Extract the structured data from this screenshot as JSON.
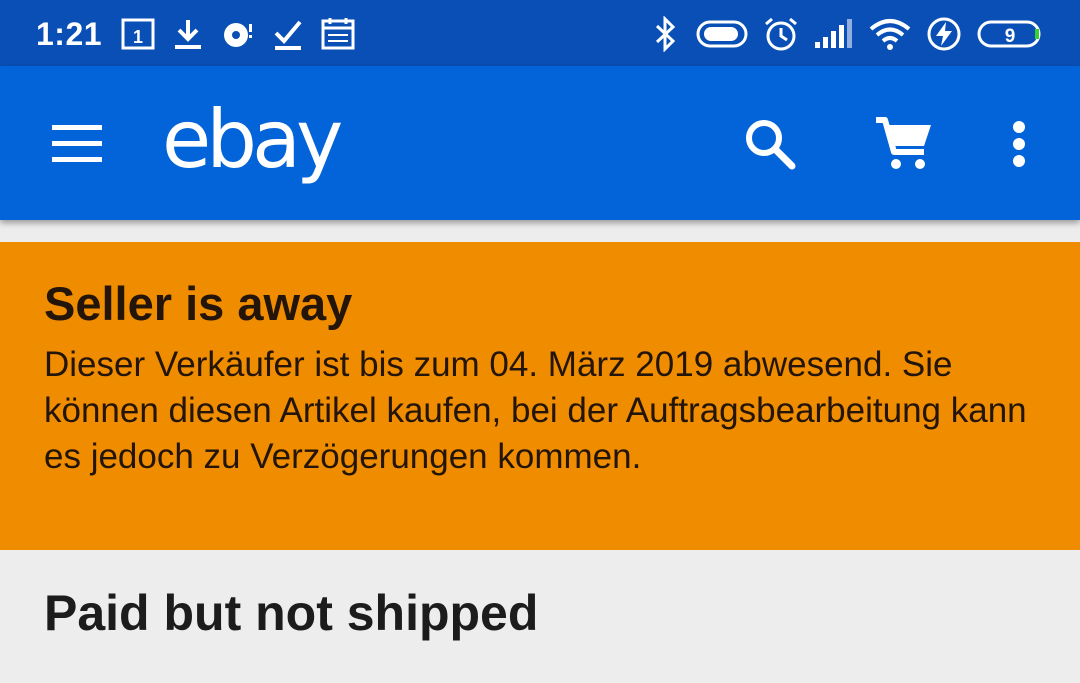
{
  "status_bar": {
    "time": "1:21",
    "calendar_day": "1",
    "battery_level": "9",
    "icons": [
      "calendar-icon",
      "download-icon",
      "sync-icon",
      "checklist-icon",
      "planner-icon",
      "bluetooth-icon",
      "toggle-icon",
      "alarm-icon",
      "signal-icon",
      "wifi-icon",
      "charging-icon",
      "battery-icon"
    ]
  },
  "app_bar": {
    "logo_text": "ebay",
    "menu_icon": "hamburger-menu-icon",
    "search_icon": "search-icon",
    "cart_icon": "cart-icon",
    "overflow_icon": "more-vertical-icon"
  },
  "banner": {
    "title": "Seller is away",
    "message": "Dieser Verkäufer ist bis zum 04. März 2019 abwesend. Sie können diesen Artikel kaufen, bei der Auftragsbearbeitung kann es jedoch zu Verzögerungen kommen."
  },
  "order": {
    "status_heading": "Paid but not shipped"
  },
  "colors": {
    "status_bar": "#0a4fb5",
    "app_bar": "#0363d8",
    "banner": "#ef8c00",
    "background": "#ededed",
    "battery_green": "#37d12f"
  }
}
